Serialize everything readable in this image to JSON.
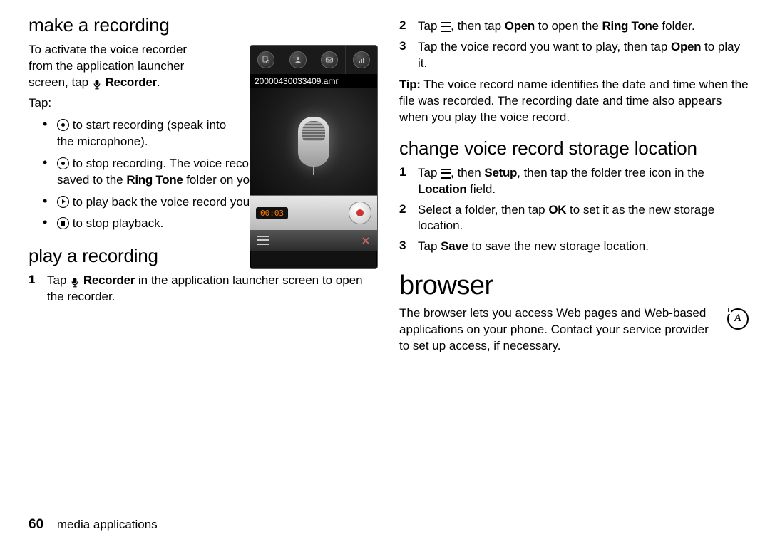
{
  "left": {
    "h_make": "make a recording",
    "intro_1": "To activate the voice recorder from the application launcher screen, tap ",
    "recorder_label": "Recorder",
    "tap_label": "Tap:",
    "bullets": {
      "b1": " to start recording (speak into the microphone).",
      "b2a": " to stop recording. The voice record is automatically saved to the ",
      "b2_ring": "Ring Tone",
      "b2b": " folder on your phone.",
      "b3": " to play back the voice record you just made.",
      "b4": " to stop playback."
    },
    "h_play": "play a recording",
    "play_step1_a": "Tap ",
    "play_step1_b": " in the application launcher screen to open the recorder."
  },
  "phone": {
    "filename": "20000430033409.amr",
    "time": "00:03",
    "tab_icons": [
      "doc-music-icon",
      "contacts-icon",
      "mail-icon",
      "bars-icon"
    ]
  },
  "right": {
    "step2_a": "Tap ",
    "step2_b": ", then tap ",
    "open_label": "Open",
    "step2_c": " to open the ",
    "ring_label": "Ring Tone",
    "step2_d": " folder.",
    "step3_a": "Tap the voice record you want to play, then tap ",
    "step3_b": " to play it.",
    "tip_label": "Tip:",
    "tip_body": " The voice record name identifies the date and time when the file was recorded. The recording date and time also appears when you play the voice record.",
    "h_change": "change voice record storage location",
    "c1_a": "Tap ",
    "c1_b": ", then ",
    "setup_label": "Setup",
    "c1_c": ", then tap the folder tree icon in the ",
    "location_label": "Location",
    "c1_d": " field.",
    "c2_a": "Select a folder, then tap ",
    "ok_label": "OK",
    "c2_b": " to set it as the new storage location.",
    "c3_a": "Tap ",
    "save_label": "Save",
    "c3_b": " to save the new storage location.",
    "h_browser": "browser",
    "browser_body": "The browser lets you access Web pages and Web-based applications on your phone. Contact your service provider to set up access, if necessary.",
    "accessory_glyph": "A"
  },
  "footer": {
    "page": "60",
    "section": "media applications"
  },
  "numbers": {
    "n1": "1",
    "n2": "2",
    "n3": "3"
  }
}
